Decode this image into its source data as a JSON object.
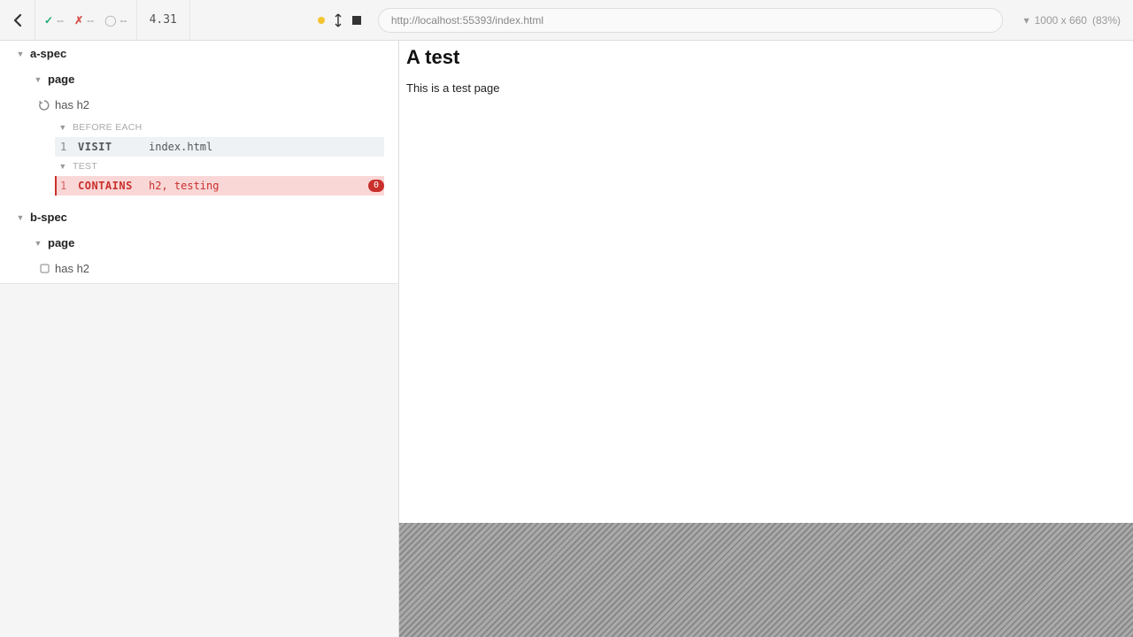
{
  "header": {
    "stats": {
      "pass": "--",
      "fail": "--",
      "pending": "--"
    },
    "timer": "4.31",
    "url": "http://localhost:55393/index.html",
    "viewport": {
      "size": "1000 x 660",
      "scale": "(83%)"
    }
  },
  "specs": [
    {
      "name": "a-spec",
      "suites": [
        {
          "name": "page",
          "tests": [
            {
              "name": "has h2",
              "state": "running",
              "sections": [
                {
                  "label": "BEFORE EACH",
                  "commands": [
                    {
                      "num": "1",
                      "name": "VISIT",
                      "args": "index.html",
                      "status": "ok"
                    }
                  ]
                },
                {
                  "label": "TEST",
                  "commands": [
                    {
                      "num": "1",
                      "name": "CONTAINS",
                      "args": "h2, testing",
                      "status": "fail",
                      "badge": "0"
                    }
                  ]
                }
              ]
            }
          ]
        }
      ]
    },
    {
      "name": "b-spec",
      "suites": [
        {
          "name": "page",
          "tests": [
            {
              "name": "has h2",
              "state": "pending"
            }
          ]
        }
      ]
    }
  ],
  "preview": {
    "heading": "A test",
    "body": "This is a test page"
  }
}
